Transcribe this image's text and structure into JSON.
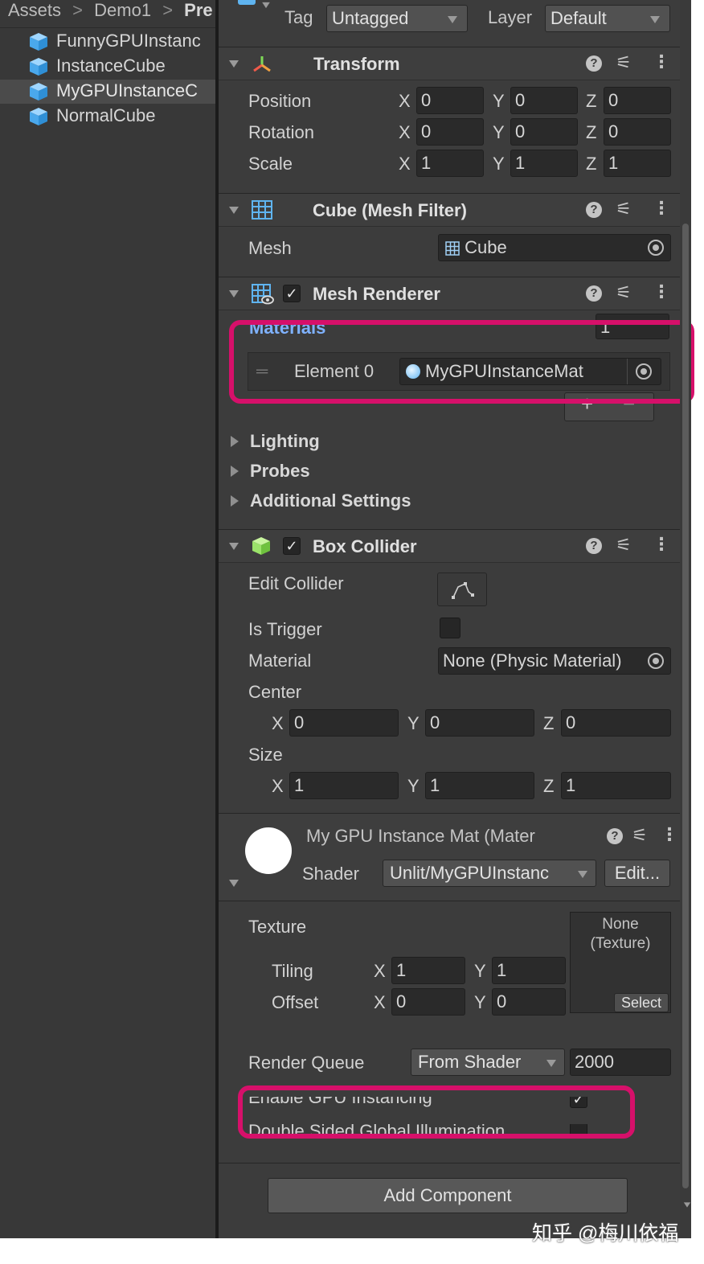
{
  "breadcrumb": {
    "items": [
      "Assets",
      "Demo1",
      "Pre"
    ]
  },
  "project_items": [
    "FunnyGPUInstanc",
    "InstanceCube",
    "MyGPUInstanceC",
    "NormalCube"
  ],
  "object_header": {
    "tag_label": "Tag",
    "tag_value": "Untagged",
    "layer_label": "Layer",
    "layer_value": "Default"
  },
  "transform": {
    "title": "Transform",
    "rows": [
      {
        "label": "Position",
        "x": "0",
        "y": "0",
        "z": "0"
      },
      {
        "label": "Rotation",
        "x": "0",
        "y": "0",
        "z": "0"
      },
      {
        "label": "Scale",
        "x": "1",
        "y": "1",
        "z": "1"
      }
    ]
  },
  "axis": {
    "x": "X",
    "y": "Y",
    "z": "Z"
  },
  "mesh_filter": {
    "title": "Cube (Mesh Filter)",
    "mesh_label": "Mesh",
    "mesh_value": "Cube"
  },
  "mesh_renderer": {
    "title": "Mesh Renderer",
    "materials_label": "Materials",
    "materials_count": "1",
    "element_label": "Element 0",
    "element_value": "MyGPUInstanceMat",
    "add_symbol": "+",
    "remove_symbol": "−",
    "sections": [
      "Lighting",
      "Probes",
      "Additional Settings"
    ]
  },
  "box_collider": {
    "title": "Box Collider",
    "edit_collider_label": "Edit Collider",
    "is_trigger_label": "Is Trigger",
    "material_label": "Material",
    "material_value": "None (Physic Material)",
    "center_label": "Center",
    "center": {
      "x": "0",
      "y": "0",
      "z": "0"
    },
    "size_label": "Size",
    "size": {
      "x": "1",
      "y": "1",
      "z": "1"
    }
  },
  "material": {
    "title": "My GPU Instance Mat (Mater",
    "shader_label": "Shader",
    "shader_value": "Unlit/MyGPUInstanc",
    "edit_button": "Edit...",
    "texture_label": "Texture",
    "texture_slot_line1": "None",
    "texture_slot_line2": "(Texture)",
    "select_button": "Select",
    "tiling_label": "Tiling",
    "tiling": {
      "x": "1",
      "y": "1"
    },
    "offset_label": "Offset",
    "offset": {
      "x": "0",
      "y": "0"
    },
    "render_queue_label": "Render Queue",
    "render_queue_mode": "From Shader",
    "render_queue_value": "2000",
    "gpu_instancing_label": "Enable GPU Instancing",
    "double_sided_label": "Double Sided Global Illumination"
  },
  "add_component_button": "Add Component",
  "watermark": "知乎 @梅川依福",
  "colors": {
    "panel": "#3c3c3c",
    "field": "#2a2a2a",
    "highlight": "#d6106a",
    "link_blue": "#7fb2ff",
    "cube_blue": "#5fb4f0",
    "collider_green": "#9be36a"
  }
}
